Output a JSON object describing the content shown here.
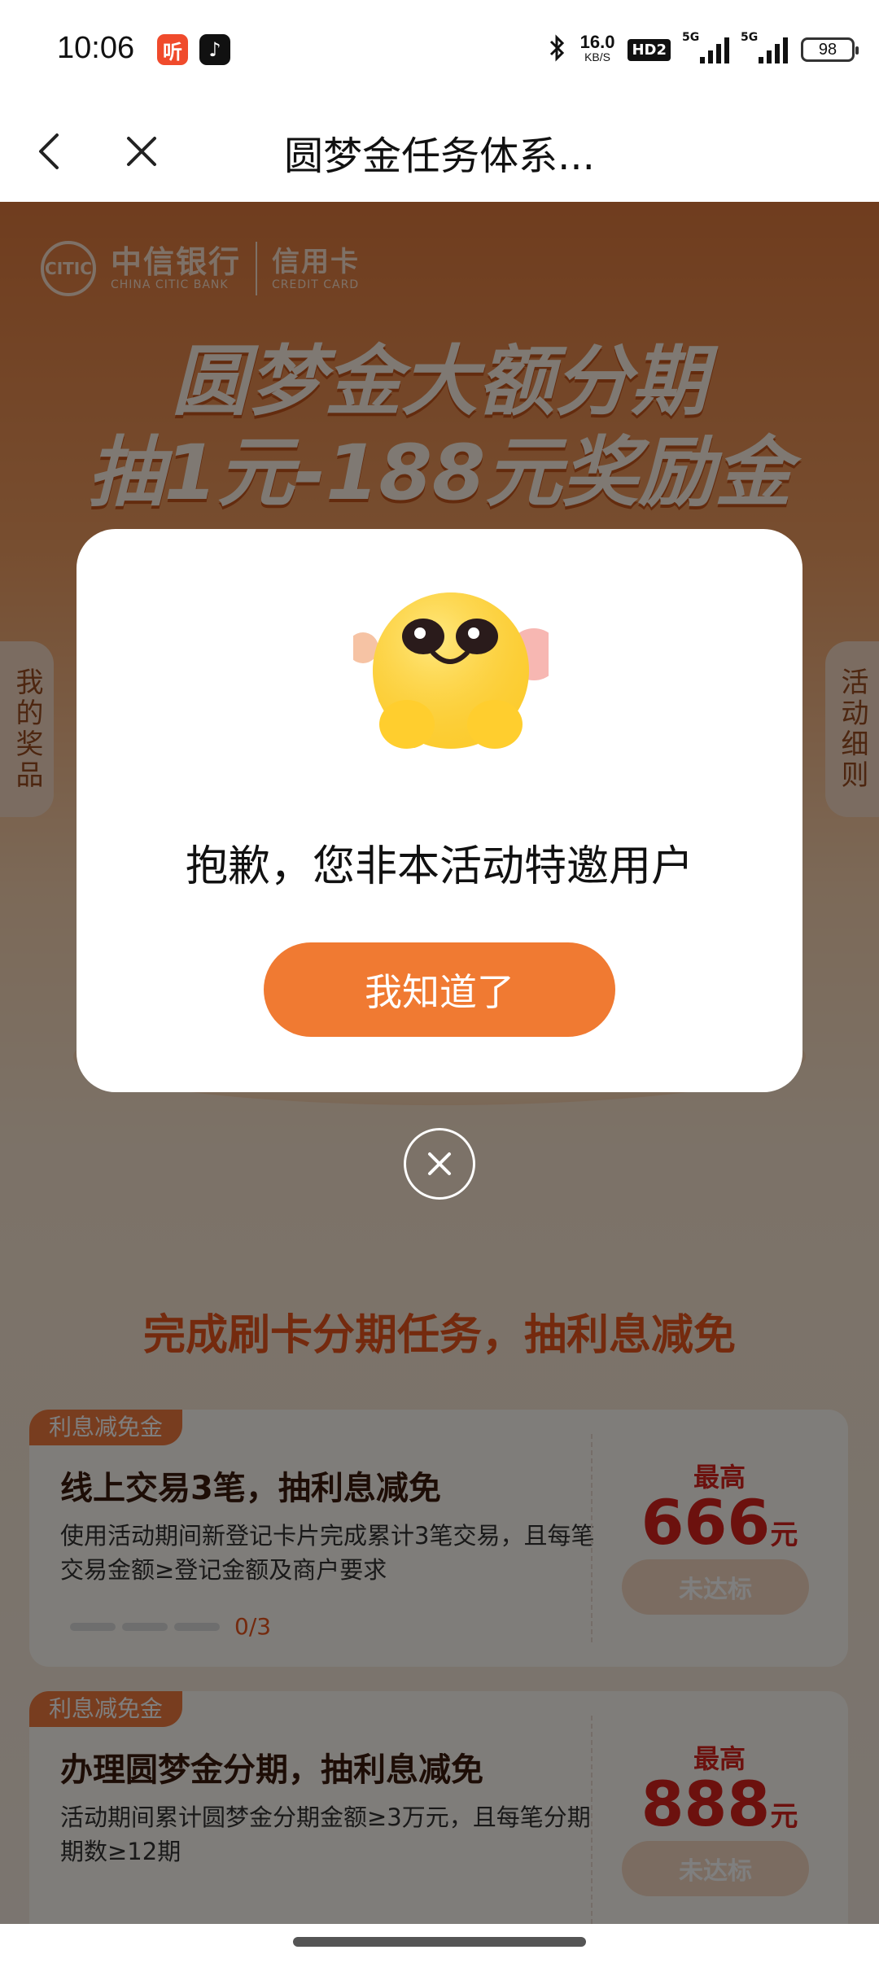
{
  "status_bar": {
    "time": "10:06",
    "app_icon_1": "听",
    "app_icon_2": "♪",
    "net_speed_value": "16.0",
    "net_speed_unit": "KB/S",
    "hd_label": "HD2",
    "signal1_label": "5G",
    "signal2_label": "5G",
    "battery": "98"
  },
  "nav": {
    "title": "圆梦金任务体系..."
  },
  "banner": {
    "bank_cn": "中信银行",
    "bank_en": "CHINA CITIC BANK",
    "card_cn": "信用卡",
    "card_en": "CREDIT CARD",
    "title_line1": "圆梦金大额分期",
    "title_line2": "抽1元-188元奖励金"
  },
  "side_tabs": {
    "left": "我的奖品",
    "right": "活动细则"
  },
  "section_title": "完成刷卡分期任务，抽利息减免",
  "tasks": [
    {
      "tag": "利息减免金",
      "name": "线上交易3笔，抽利息减免",
      "desc": "使用活动期间新登记卡片完成累计3笔交易，且每笔交易金额≥登记金额及商户要求",
      "progress": "0/3",
      "max_label": "最高",
      "amount": "666",
      "unit": "元",
      "button": "未达标"
    },
    {
      "tag": "利息减免金",
      "name": "办理圆梦金分期，抽利息减免",
      "desc": "活动期间累计圆梦金分期金额≥3万元，且每笔分期期数≥12期",
      "max_label": "最高",
      "amount": "888",
      "unit": "元",
      "button": "未达标"
    }
  ],
  "modal": {
    "message": "抱歉，您非本活动特邀用户",
    "button": "我知道了"
  },
  "colors": {
    "accent": "#f07a32",
    "amount_red": "#d8231c"
  }
}
